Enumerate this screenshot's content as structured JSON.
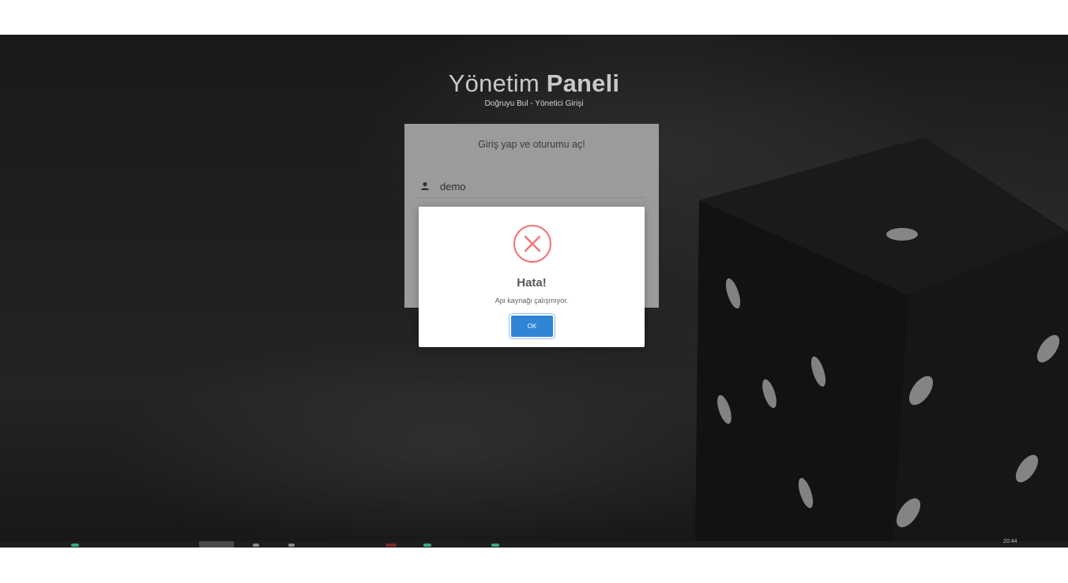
{
  "header": {
    "title_light": "Yönetim",
    "title_bold": "Paneli",
    "subtitle": "Doğruyu Bul - Yönetici Girişi"
  },
  "login": {
    "message": "Giriş yap ve oturumu aç!",
    "username_value": "demo"
  },
  "dialog": {
    "icon": "error-x-icon",
    "title": "Hata!",
    "text": "Api kaynağı çalışmıyor.",
    "ok_label": "OK",
    "icon_color": "#f27474",
    "button_color": "#3085d6"
  },
  "taskbar": {
    "clock": "20:44"
  }
}
